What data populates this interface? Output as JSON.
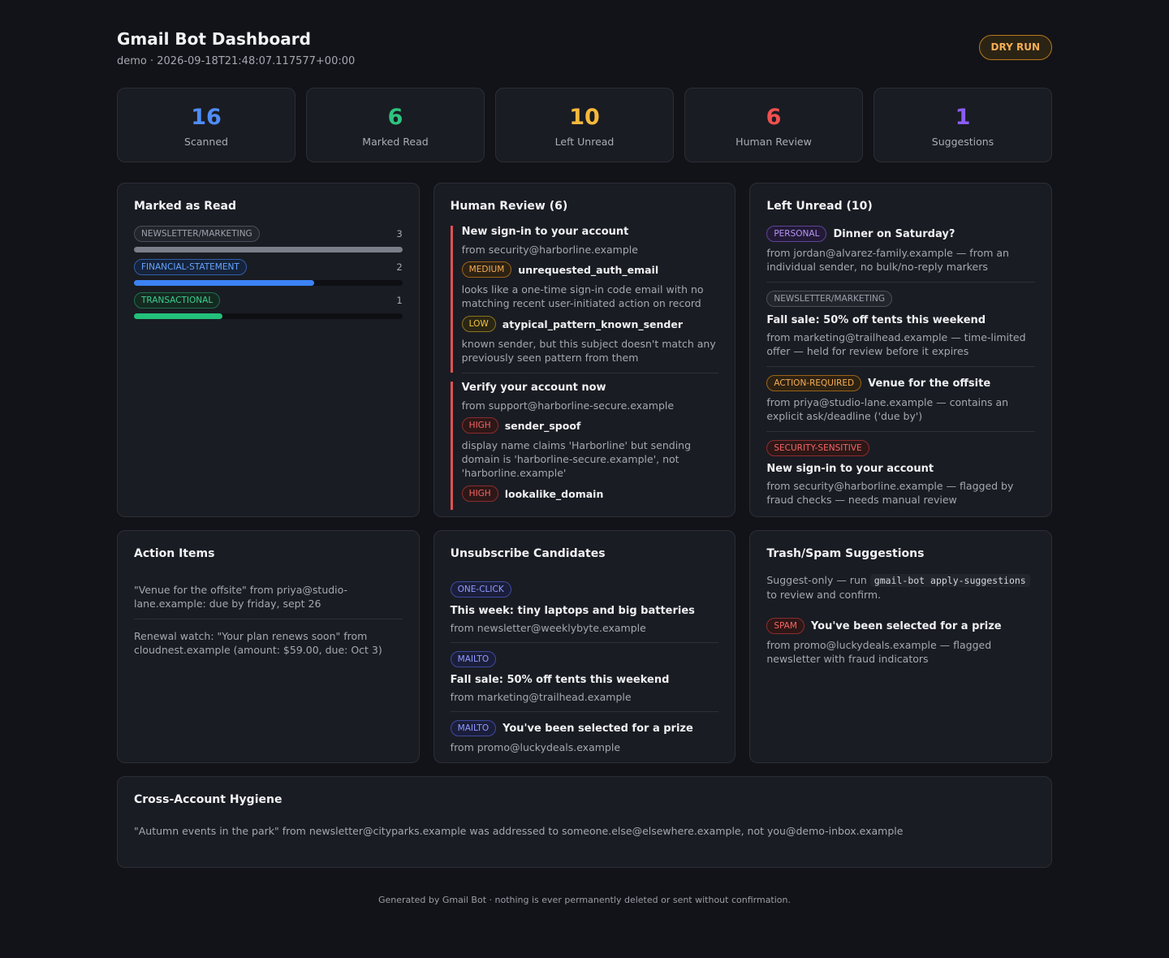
{
  "header": {
    "title": "Gmail Bot Dashboard",
    "subtitle": "demo · 2026-09-18T21:48:07.117577+00:00",
    "badge": "DRY RUN"
  },
  "stats": [
    {
      "value": "16",
      "label": "Scanned",
      "color": "#4f8cf7"
    },
    {
      "value": "6",
      "label": "Marked Read",
      "color": "#2ec47f"
    },
    {
      "value": "10",
      "label": "Left Unread",
      "color": "#f6b93b"
    },
    {
      "value": "6",
      "label": "Human Review",
      "color": "#f0504f"
    },
    {
      "value": "1",
      "label": "Suggestions",
      "color": "#8b5cf6"
    }
  ],
  "marked_read": {
    "title": "Marked as Read",
    "rows": [
      {
        "label": "NEWSLETTER/MARKETING",
        "count": "3",
        "fraction": 1.0,
        "color": "#7a7e88"
      },
      {
        "label": "FINANCIAL-STATEMENT",
        "count": "2",
        "fraction": 0.67,
        "color": "#3b82f6"
      },
      {
        "label": "TRANSACTIONAL",
        "count": "1",
        "fraction": 0.33,
        "color": "#22c07a"
      }
    ]
  },
  "human_review": {
    "title": "Human Review (6)",
    "items": [
      {
        "subject": "New sign-in to your account",
        "from": "from security@harborline.example",
        "flags": [
          {
            "level": "MEDIUM",
            "name": "unrequested_auth_email",
            "desc": "looks like a one-time sign-in code email with no matching recent user-initiated action on record"
          },
          {
            "level": "LOW",
            "name": "atypical_pattern_known_sender",
            "desc": "known sender, but this subject doesn't match any previously seen pattern from them"
          }
        ]
      },
      {
        "subject": "Verify your account now",
        "from": "from support@harborline-secure.example",
        "flags": [
          {
            "level": "HIGH",
            "name": "sender_spoof",
            "desc": "display name claims 'Harborline' but sending domain is 'harborline-secure.example', not 'harborline.example'"
          },
          {
            "level": "HIGH",
            "name": "lookalike_domain",
            "desc": ""
          }
        ]
      }
    ]
  },
  "left_unread": {
    "title": "Left Unread (10)",
    "items": [
      {
        "tag": "PERSONAL",
        "subject": "Dinner on Saturday?",
        "desc": "from jordan@alvarez-family.example — from an individual sender, no bulk/no-reply markers"
      },
      {
        "tag": "NEWSLETTER/MARKETING",
        "subject": "Fall sale: 50% off tents this weekend",
        "desc": "from marketing@trailhead.example — time-limited offer — held for review before it expires"
      },
      {
        "tag": "ACTION-REQUIRED",
        "subject": "Venue for the offsite",
        "desc": "from priya@studio-lane.example — contains an explicit ask/deadline ('due by')"
      },
      {
        "tag": "SECURITY-SENSITIVE",
        "subject": "New sign-in to your account",
        "desc": "from security@harborline.example — flagged by fraud checks — needs manual review"
      }
    ]
  },
  "action_items": {
    "title": "Action Items",
    "items": [
      "\"Venue for the offsite\" from priya@studio-lane.example: due by friday, sept 26",
      "Renewal watch: \"Your plan renews soon\" from cloudnest.example (amount: $59.00, due: Oct 3)"
    ]
  },
  "unsubscribe": {
    "title": "Unsubscribe Candidates",
    "items": [
      {
        "method": "ONE-CLICK",
        "subject": "This week: tiny laptops and big batteries",
        "from": "from newsletter@weeklybyte.example"
      },
      {
        "method": "MAILTO",
        "subject": "Fall sale: 50% off tents this weekend",
        "from": "from marketing@trailhead.example"
      },
      {
        "method": "MAILTO",
        "subject": "You've been selected for a prize",
        "from": "from promo@luckydeals.example"
      }
    ]
  },
  "trash": {
    "title": "Trash/Spam Suggestions",
    "intro_before": "Suggest-only — run",
    "command": "gmail-bot apply-suggestions",
    "intro_after": "to review and confirm.",
    "items": [
      {
        "tag": "SPAM",
        "subject": "You've been selected for a prize",
        "desc": "from promo@luckydeals.example — flagged newsletter with fraud indicators"
      }
    ]
  },
  "hygiene": {
    "title": "Cross-Account Hygiene",
    "text": "\"Autumn events in the park\" from newsletter@cityparks.example was addressed to someone.else@elsewhere.example, not you@demo-inbox.example"
  },
  "footer": "Generated by Gmail Bot · nothing is ever permanently deleted or sent without confirmation."
}
